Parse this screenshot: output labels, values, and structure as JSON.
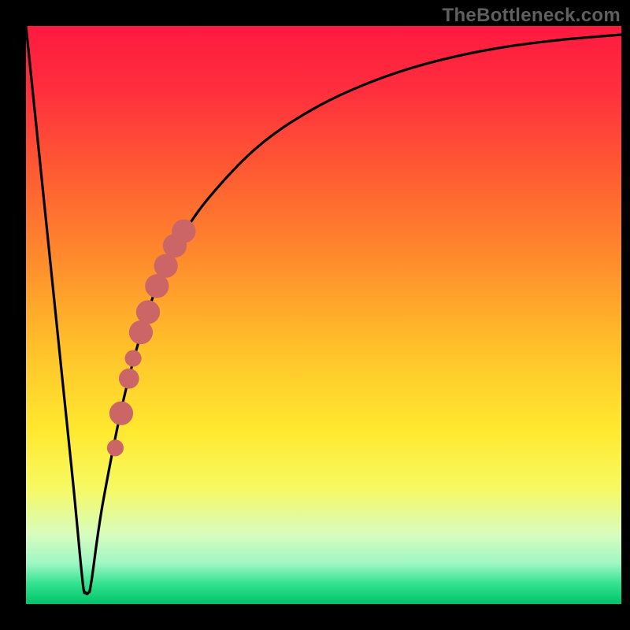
{
  "watermark": "TheBottleneck.com",
  "gradient": {
    "stops": [
      {
        "offset": 0.0,
        "color": "#ff1a3f"
      },
      {
        "offset": 0.1,
        "color": "#ff2c3e"
      },
      {
        "offset": 0.25,
        "color": "#ff5a33"
      },
      {
        "offset": 0.4,
        "color": "#ff8a2c"
      },
      {
        "offset": 0.55,
        "color": "#ffbf2a"
      },
      {
        "offset": 0.7,
        "color": "#ffe92f"
      },
      {
        "offset": 0.8,
        "color": "#f7f963"
      },
      {
        "offset": 0.88,
        "color": "#d8fcbf"
      },
      {
        "offset": 0.93,
        "color": "#9df7c4"
      },
      {
        "offset": 0.965,
        "color": "#33e28f"
      },
      {
        "offset": 1.0,
        "color": "#00c46a"
      }
    ]
  },
  "chart_data": {
    "type": "line",
    "title": "",
    "xlabel": "",
    "ylabel": "",
    "xlim": [
      0,
      100
    ],
    "ylim": [
      0,
      100
    ],
    "grid": false,
    "series": [
      {
        "name": "bottleneck-curve",
        "x": [
          0,
          2,
          4,
          6,
          8,
          9.5,
          10,
          10.5,
          11,
          13,
          17,
          22,
          27,
          33,
          40,
          48,
          56,
          64,
          72,
          80,
          88,
          94,
          100
        ],
        "y": [
          100,
          80,
          60,
          40,
          20,
          4,
          2,
          2,
          4,
          18,
          38,
          55,
          65,
          73,
          80,
          85.5,
          89.5,
          92.5,
          94.7,
          96.3,
          97.4,
          98,
          98.5
        ]
      }
    ],
    "markers": [
      {
        "name": "highlight-dot",
        "x": 15.0,
        "y": 27,
        "r": 1.4
      },
      {
        "name": "highlight-dot",
        "x": 16.0,
        "y": 33,
        "r": 2.0
      },
      {
        "name": "highlight-dot",
        "x": 17.3,
        "y": 39,
        "r": 1.7
      },
      {
        "name": "highlight-dot",
        "x": 18.0,
        "y": 42.5,
        "r": 1.4
      },
      {
        "name": "highlight-dot",
        "x": 19.3,
        "y": 47,
        "r": 2.0
      },
      {
        "name": "highlight-dot",
        "x": 20.5,
        "y": 50.5,
        "r": 2.0
      },
      {
        "name": "highlight-dot",
        "x": 22.0,
        "y": 55,
        "r": 2.0
      },
      {
        "name": "highlight-dot",
        "x": 23.5,
        "y": 58.5,
        "r": 2.0
      },
      {
        "name": "highlight-dot",
        "x": 25.0,
        "y": 62,
        "r": 2.0
      },
      {
        "name": "highlight-dot",
        "x": 26.5,
        "y": 64.5,
        "r": 2.0
      }
    ],
    "marker_color": "#cc6666"
  }
}
